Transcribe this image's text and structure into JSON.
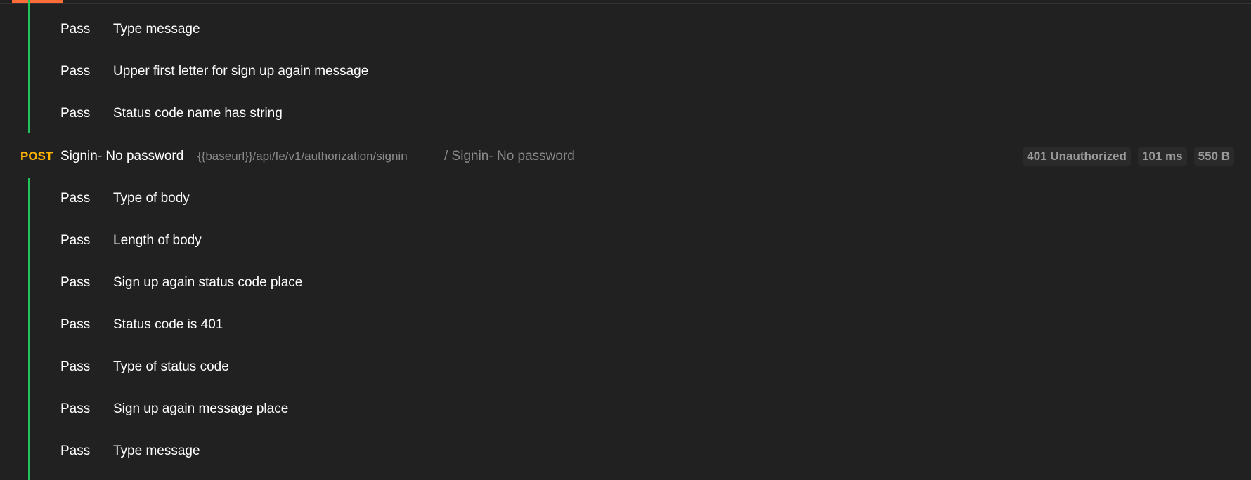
{
  "group1": {
    "tests": [
      {
        "status": "Pass",
        "name": "Type message"
      },
      {
        "status": "Pass",
        "name": "Upper first letter for sign up again message"
      },
      {
        "status": "Pass",
        "name": "Status code name has string"
      }
    ]
  },
  "request": {
    "method": "POST",
    "name": "Signin- No password",
    "url": "{{baseurl}}/api/fe/v1/authorization/signin",
    "path": "/ Signin- No password",
    "status": "401 Unauthorized",
    "time": "101 ms",
    "size": "550 B"
  },
  "group2": {
    "tests": [
      {
        "status": "Pass",
        "name": "Type of body"
      },
      {
        "status": "Pass",
        "name": "Length of body"
      },
      {
        "status": "Pass",
        "name": "Sign up again status code place"
      },
      {
        "status": "Pass",
        "name": "Status code is 401"
      },
      {
        "status": "Pass",
        "name": "Type of status code"
      },
      {
        "status": "Pass",
        "name": "Sign up again message place"
      },
      {
        "status": "Pass",
        "name": "Type message"
      }
    ]
  },
  "colors": {
    "background": "#212121",
    "pass_bar": "#21c45a",
    "method_post": "#ffb400",
    "active_tab": "#ff6c37"
  }
}
